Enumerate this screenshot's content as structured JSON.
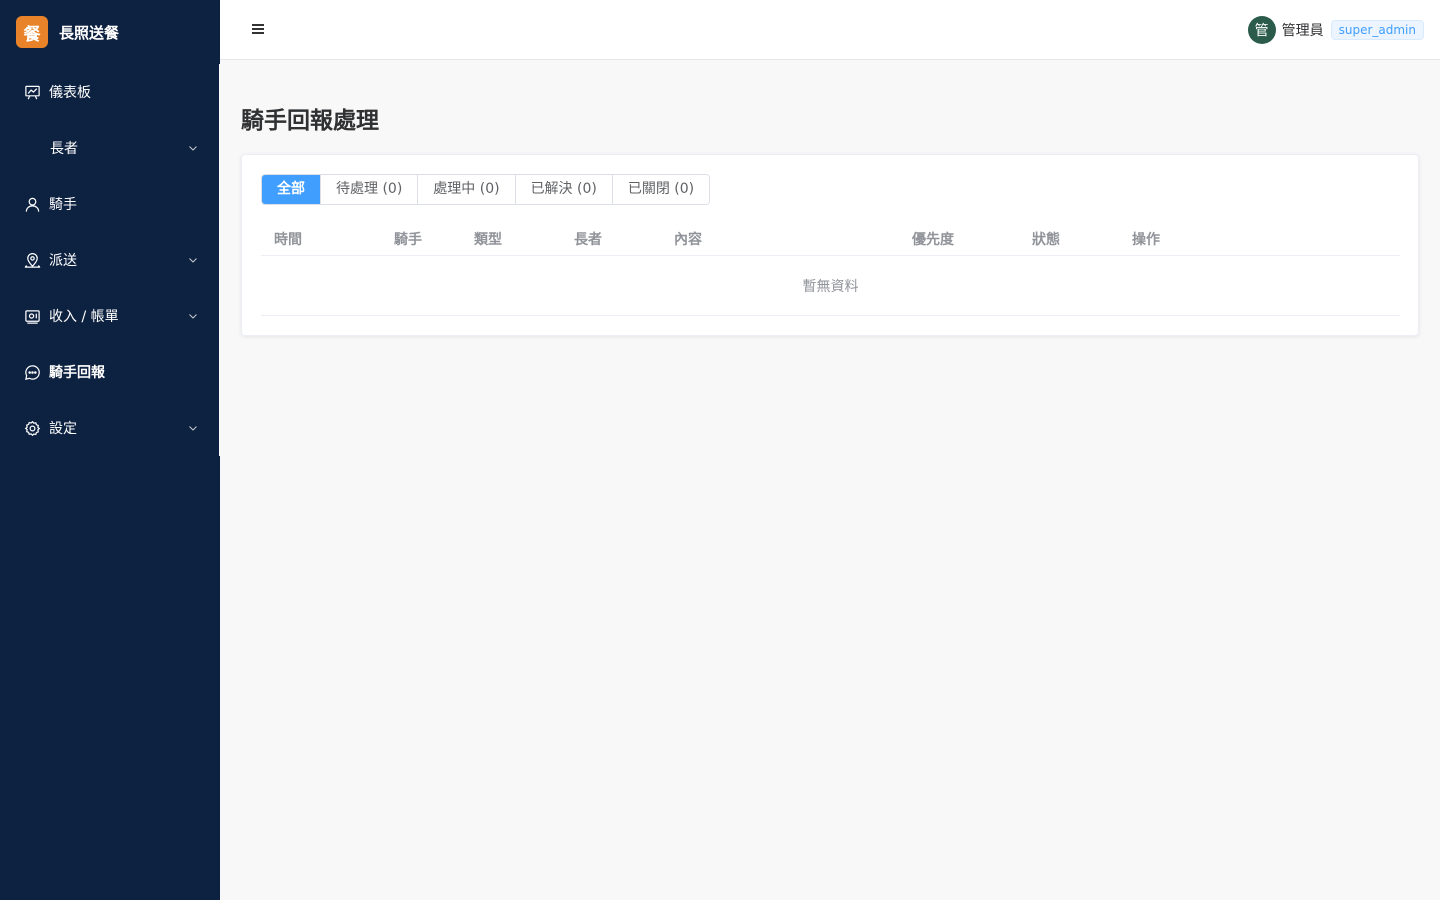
{
  "brand": {
    "logo_text": "餐",
    "name": "長照送餐"
  },
  "sidebar": {
    "items": [
      {
        "label": "儀表板",
        "icon": "dashboard-icon",
        "has_submenu": false
      },
      {
        "label": "長者",
        "icon": "",
        "has_submenu": true
      },
      {
        "label": "騎手",
        "icon": "user-icon",
        "has_submenu": false
      },
      {
        "label": "派送",
        "icon": "location-icon",
        "has_submenu": true
      },
      {
        "label": "收入 / 帳單",
        "icon": "wallet-icon",
        "has_submenu": true
      },
      {
        "label": "騎手回報",
        "icon": "chat-icon",
        "has_submenu": false,
        "active": true
      },
      {
        "label": "設定",
        "icon": "gear-icon",
        "has_submenu": true
      }
    ]
  },
  "header": {
    "menu_icon": "hamburger-icon",
    "user": {
      "avatar_text": "管",
      "name": "管理員",
      "role": "super_admin"
    }
  },
  "main": {
    "title": "騎手回報處理",
    "tabs": [
      {
        "label": "全部",
        "active": true
      },
      {
        "label": "待處理 (0)"
      },
      {
        "label": "處理中 (0)"
      },
      {
        "label": "已解決 (0)"
      },
      {
        "label": "已關閉 (0)"
      }
    ],
    "table": {
      "columns": [
        "時間",
        "騎手",
        "類型",
        "長者",
        "內容",
        "優先度",
        "狀態",
        "操作"
      ],
      "empty_text": "暫無資料"
    }
  },
  "colors": {
    "sidebar_bg": "#0d2140",
    "brand_logo": "#e8832a",
    "accent": "#409eff",
    "avatar_bg": "#2b5b4b"
  }
}
